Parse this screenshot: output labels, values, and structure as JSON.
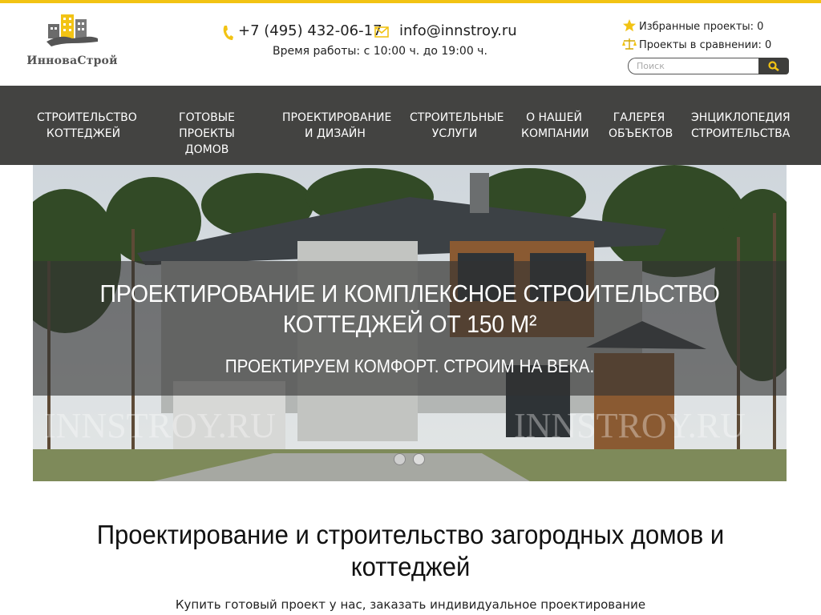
{
  "colors": {
    "accent": "#f2c314",
    "nav_bg": "#434341",
    "text": "#222222"
  },
  "logo": {
    "text": "ИнноваСтрой",
    "icon": "city-buildings-hand-logo"
  },
  "header": {
    "phone": "+7 (495) 432-06-17",
    "email": "info@innstroy.ru",
    "hours": "Время работы: с 10:00 ч. до 19:00 ч.",
    "favorites": "Избранные проекты: 0",
    "compare": "Проекты в сравнении: 0",
    "search": {
      "placeholder": "Поиск"
    },
    "icons": [
      "phone-icon",
      "mail-icon",
      "star-icon",
      "scales-icon",
      "search-icon"
    ]
  },
  "nav": {
    "items": [
      {
        "label": "СТРОИТЕЛЬСТВО\nКОТТЕДЖЕЙ"
      },
      {
        "label": "ГОТОВЫЕ ПРОЕКТЫ\nДОМОВ"
      },
      {
        "label": "ПРОЕКТИРОВАНИЕ\nИ ДИЗАЙН"
      },
      {
        "label": "СТРОИТЕЛЬНЫЕ\nУСЛУГИ"
      },
      {
        "label": "О НАШЕЙ\nКОМПАНИИ"
      },
      {
        "label": "ГАЛЕРЕЯ\nОБЪЕКТОВ"
      },
      {
        "label": "ЭНЦИКЛОПЕДИЯ\nСТРОИТЕЛЬСТВА"
      }
    ]
  },
  "hero": {
    "title": "ПРОЕКТИРОВАНИЕ И КОМПЛЕКСНОЕ СТРОИТЕЛЬСТВО\nКОТТЕДЖЕЙ ОТ 150 М²",
    "subtitle": "ПРОЕКТИРУЕМ КОМФОРТ. СТРОИМ НА ВЕКА.",
    "watermark": "INNSTROY.RU",
    "slides": 2,
    "active_slide": 1
  },
  "main": {
    "title": "Проектирование и строительство загородных домов и коттеджей",
    "subtitle": "Купить готовый проект у нас, заказать индивидуальное проектирование"
  }
}
